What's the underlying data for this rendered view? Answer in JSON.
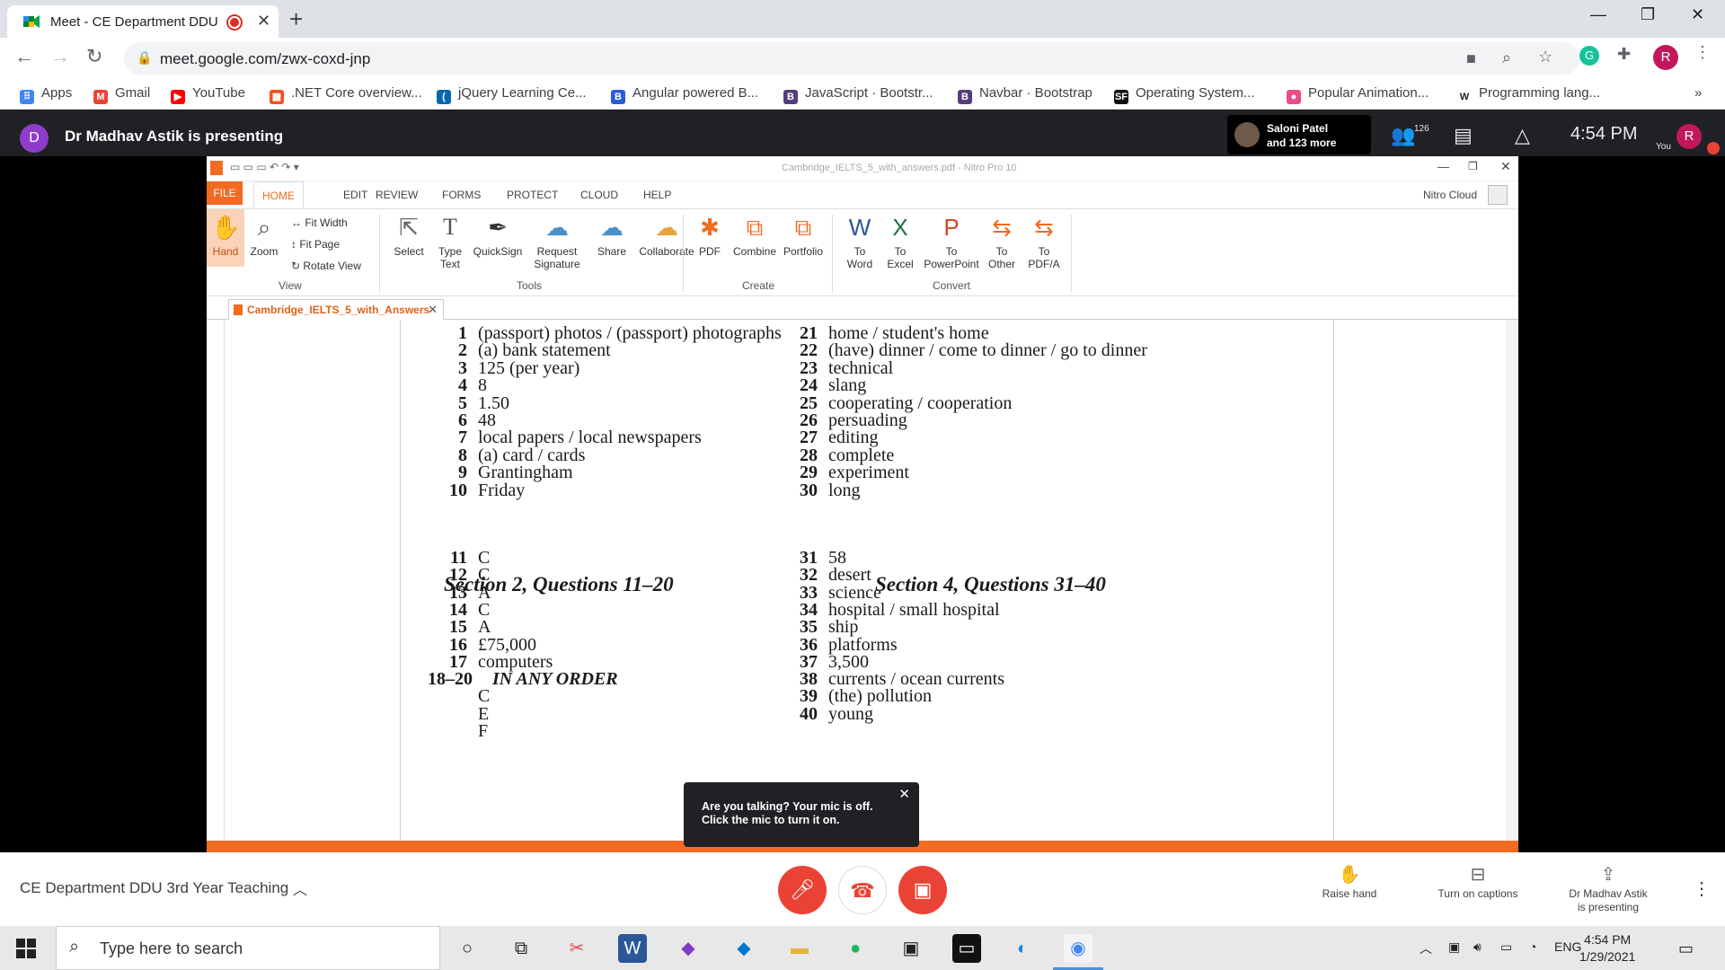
{
  "browser": {
    "tab_title": "Meet - CE Department DDU",
    "url": "meet.google.com/zwx-coxd-jnp",
    "bookmarks": [
      {
        "label": "Apps",
        "color": "#4285f4",
        "glyph": "⠿"
      },
      {
        "label": "Gmail",
        "color": "#ea4335",
        "glyph": "M"
      },
      {
        "label": "YouTube",
        "color": "#ff0000",
        "glyph": "▶"
      },
      {
        "label": ".NET Core overview...",
        "color": "#f25022",
        "glyph": "▦"
      },
      {
        "label": "jQuery Learning Ce...",
        "color": "#0769ad",
        "glyph": "("
      },
      {
        "label": "Angular powered B...",
        "color": "#2b5cd8",
        "glyph": "B"
      },
      {
        "label": "JavaScript · Bootstr...",
        "color": "#563d7c",
        "glyph": "B"
      },
      {
        "label": "Navbar · Bootstrap",
        "color": "#563d7c",
        "glyph": "B"
      },
      {
        "label": "Operating System...",
        "color": "#111111",
        "glyph": "SF"
      },
      {
        "label": "Popular Animation...",
        "color": "#ea4c89",
        "glyph": "●"
      },
      {
        "label": "Programming lang...",
        "color": "#ffffff",
        "glyph": "W"
      }
    ]
  },
  "meet": {
    "presenter_initial": "D",
    "presenting_text": "Dr Madhav Astik is presenting",
    "participant_name": "Saloni Patel",
    "participant_more": "and 123 more",
    "participant_count": "126",
    "time": "4:54 PM",
    "you_initial": "R",
    "you_label": "You",
    "meeting_name": "CE Department DDU 3rd Year Teaching",
    "toast": "Are you talking? Your mic is off. Click the mic to turn it on.",
    "actions": {
      "raise_hand": "Raise hand",
      "captions": "Turn on captions",
      "presenting_line1": "Dr Madhav Astik",
      "presenting_line2": "is presenting"
    }
  },
  "nitro": {
    "window_title": "Cambridge_IELTS_5_with_answers.pdf - Nitro Pro 10",
    "menus": [
      "FILE",
      "HOME",
      "EDIT",
      "REVIEW",
      "FORMS",
      "PROTECT",
      "CLOUD",
      "HELP"
    ],
    "cloud_label": "Nitro Cloud",
    "ribbon": {
      "hand": "Hand",
      "zoom": "Zoom",
      "fit_width": "Fit Width",
      "fit_page": "Fit Page",
      "rotate_view": "Rotate View",
      "select": "Select",
      "type_text_1": "Type",
      "type_text_2": "Text",
      "quicksign": "QuickSign",
      "request_sig_1": "Request",
      "request_sig_2": "Signature",
      "share": "Share",
      "collaborate": "Collaborate",
      "pdf": "PDF",
      "combine": "Combine",
      "portfolio": "Portfolio",
      "to": "To",
      "to_word": "Word",
      "to_excel": "Excel",
      "to_ppt": "PowerPoint",
      "to_other": "Other",
      "to_pdfa": "PDF/A",
      "group_view": "View",
      "group_tools": "Tools",
      "group_create": "Create",
      "group_convert": "Convert"
    },
    "doc_tab": "Cambridge_IELTS_5_with_Answers"
  },
  "answers": {
    "col1": [
      {
        "n": "1",
        "t": "(passport) photos / (passport) photographs"
      },
      {
        "n": "2",
        "t": "(a) bank statement"
      },
      {
        "n": "3",
        "t": "125 (per year)"
      },
      {
        "n": "4",
        "t": "8"
      },
      {
        "n": "5",
        "t": "1.50"
      },
      {
        "n": "6",
        "t": "48"
      },
      {
        "n": "7",
        "t": "local papers / local newspapers"
      },
      {
        "n": "8",
        "t": "(a) card / cards"
      },
      {
        "n": "9",
        "t": "Grantingham"
      },
      {
        "n": "10",
        "t": "Friday"
      }
    ],
    "col2": [
      {
        "n": "21",
        "t": "home / student's home"
      },
      {
        "n": "22",
        "t": "(have) dinner / come to dinner / go to dinner"
      },
      {
        "n": "23",
        "t": "technical"
      },
      {
        "n": "24",
        "t": "slang"
      },
      {
        "n": "25",
        "t": "cooperating / cooperation"
      },
      {
        "n": "26",
        "t": "persuading"
      },
      {
        "n": "27",
        "t": "editing"
      },
      {
        "n": "28",
        "t": "complete"
      },
      {
        "n": "29",
        "t": "experiment"
      },
      {
        "n": "30",
        "t": "long"
      }
    ],
    "section2_title": "Section 2, Questions 11–20",
    "section4_title": "Section 4, Questions 31–40",
    "col3": [
      {
        "n": "11",
        "t": "C"
      },
      {
        "n": "12",
        "t": "C"
      },
      {
        "n": "13",
        "t": "A"
      },
      {
        "n": "14",
        "t": "C"
      },
      {
        "n": "15",
        "t": "A"
      },
      {
        "n": "16",
        "t": "£75,000"
      },
      {
        "n": "17",
        "t": "computers"
      },
      {
        "n": "18–20",
        "t": "IN ANY ORDER"
      },
      {
        "n": "",
        "t": "C"
      },
      {
        "n": "",
        "t": "E"
      },
      {
        "n": "",
        "t": "F"
      }
    ],
    "col4": [
      {
        "n": "31",
        "t": "58"
      },
      {
        "n": "32",
        "t": "desert"
      },
      {
        "n": "33",
        "t": "science"
      },
      {
        "n": "34",
        "t": "hospital / small hospital"
      },
      {
        "n": "35",
        "t": "ship"
      },
      {
        "n": "36",
        "t": "platforms"
      },
      {
        "n": "37",
        "t": "3,500"
      },
      {
        "n": "38",
        "t": "currents / ocean currents"
      },
      {
        "n": "39",
        "t": "(the) pollution"
      },
      {
        "n": "40",
        "t": "young"
      }
    ]
  },
  "taskbar": {
    "search_placeholder": "Type here to search",
    "lang": "ENG",
    "time": "4:54 PM",
    "date": "1/29/2021"
  }
}
